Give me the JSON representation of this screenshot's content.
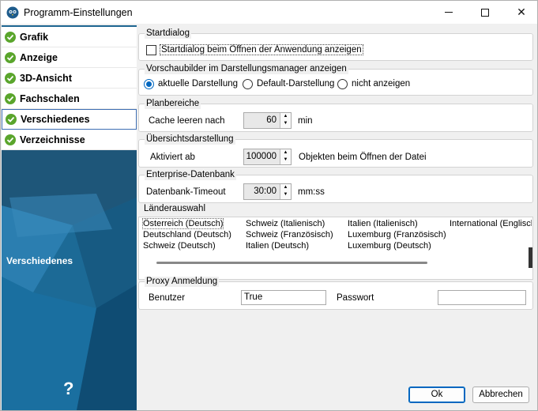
{
  "window": {
    "title": "Programm-Einstellungen",
    "app_icon": "owl-logo-icon"
  },
  "sidebar": {
    "items": [
      {
        "label": "Grafik",
        "active": false
      },
      {
        "label": "Anzeige",
        "active": false
      },
      {
        "label": "3D-Ansicht",
        "active": false
      },
      {
        "label": "Fachschalen",
        "active": false
      },
      {
        "label": "Verschiedenes",
        "active": true
      },
      {
        "label": "Verzeichnisse",
        "active": false
      }
    ],
    "section_label": "Verschiedenes",
    "help": "?"
  },
  "startdialog": {
    "legend": "Startdialog",
    "checkbox_label": "Startdialog beim Öffnen der Anwendung anzeigen",
    "checked": false
  },
  "preview": {
    "legend": "Vorschaubilder im Darstellungsmanager anzeigen",
    "options": [
      {
        "label": "aktuelle Darstellung",
        "selected": true
      },
      {
        "label": "Default-Darstellung",
        "selected": false
      },
      {
        "label": "nicht anzeigen",
        "selected": false
      }
    ]
  },
  "planbereiche": {
    "legend": "Planbereiche",
    "label": "Cache leeren nach",
    "value": "60",
    "unit": "min"
  },
  "overview": {
    "legend": "Übersichtsdarstellung",
    "label": "Aktiviert ab",
    "value": "100000",
    "unit": "Objekten beim Öffnen der Datei"
  },
  "enterprise": {
    "legend": "Enterprise-Datenbank",
    "label": "Datenbank-Timeout",
    "value": "30:00",
    "unit": "mm:ss"
  },
  "countries": {
    "legend": "Länderauswahl",
    "columns": [
      [
        "Österreich (Deutsch)",
        "Deutschland (Deutsch)",
        "Schweiz (Deutsch)"
      ],
      [
        "Schweiz (Italienisch)",
        "Schweiz (Französisch)",
        "Italien (Deutsch)"
      ],
      [
        "Italien (Italienisch)",
        "Luxemburg (Französisch)",
        "Luxemburg (Deutsch)"
      ],
      [
        "International (Englisch"
      ]
    ],
    "selected": "Österreich (Deutsch)"
  },
  "proxy": {
    "legend": "Proxy Anmeldung",
    "user_label": "Benutzer",
    "user_value": "True",
    "password_label": "Passwort",
    "password_value": ""
  },
  "buttons": {
    "ok": "Ok",
    "cancel": "Abbrechen"
  }
}
